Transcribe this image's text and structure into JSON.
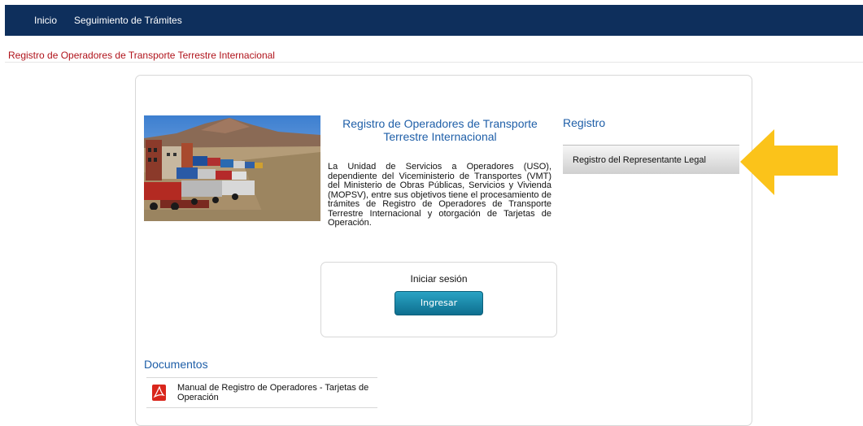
{
  "nav": {
    "items": [
      "Inicio",
      "Seguimiento de Trámites"
    ]
  },
  "breadcrumb": "Registro de Operadores de Transporte Terrestre Internacional",
  "intro": {
    "title": "Registro de Operadores de Transporte Terrestre Internacional",
    "body": "La Unidad de Servicios a Operadores (USO), dependiente del Viceministerio de Transportes (VMT) del Ministerio de Obras Públicas, Servicios y Vivienda (MOPSV), entre sus objetivos tiene el procesamiento de trámites de Registro de Operadores de Transporte Terrestre Internacional y otorgación de Tarjetas de Operación."
  },
  "login": {
    "title": "Iniciar sesión",
    "button": "Ingresar"
  },
  "registro": {
    "heading": "Registro",
    "item": "Registro del Representante Legal"
  },
  "documentos": {
    "heading": "Documentos",
    "items": [
      "Manual de Registro de Operadores - Tarjetas de Operación"
    ]
  },
  "colors": {
    "navbar": "#0e2f5c",
    "breadcrumb": "#b0131b",
    "heading_blue": "#1f5fa8",
    "button": "#1a8aab",
    "arrow": "#fbc31a"
  },
  "icons": {
    "pdf": "pdf-icon",
    "arrow": "arrow-left-icon"
  }
}
